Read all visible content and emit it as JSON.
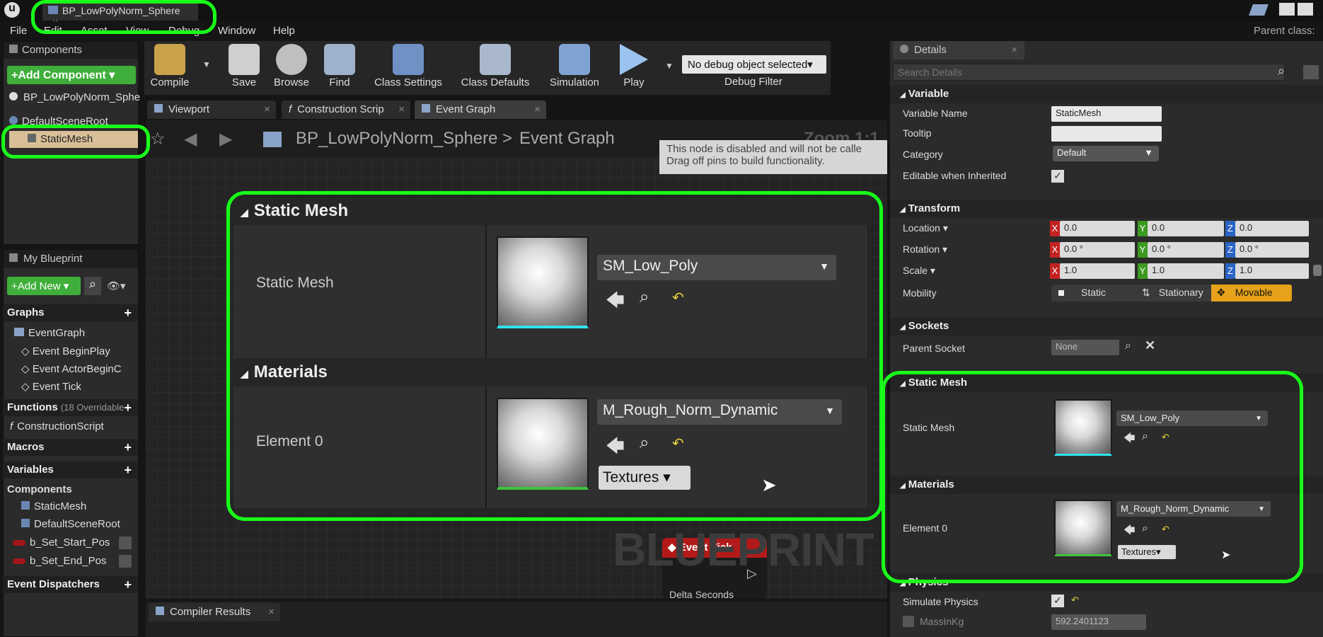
{
  "window": {
    "tab_title": "BP_LowPolyNorm_Sphere",
    "parent_class_label": "Parent class:"
  },
  "menu": [
    "File",
    "Edit",
    "Asset",
    "View",
    "Debug",
    "Window",
    "Help"
  ],
  "components_panel": {
    "title": "Components",
    "add_button": "+Add Component ▾",
    "root": "BP_LowPolyNorm_Sphe",
    "scene_root": "DefaultSceneRoot",
    "selected": "StaticMesh"
  },
  "toolbar": {
    "compile": "Compile",
    "save": "Save",
    "browse": "Browse",
    "find": "Find",
    "class_settings": "Class Settings",
    "class_defaults": "Class Defaults",
    "simulation": "Simulation",
    "play": "Play",
    "debug_select": "No debug object selected▾",
    "debug_filter": "Debug Filter"
  },
  "editor_tabs": [
    "Viewport",
    "Construction Scrip",
    "Event Graph"
  ],
  "breadcrumb": {
    "blueprint": "BP_LowPolyNorm_Sphere",
    "sep": ">",
    "graph": "Event Graph",
    "zoom": "Zoom 1:1"
  },
  "graph_tooltip": {
    "line1": "This node is disabled and will not be calle",
    "line2": "Drag off pins to build functionality."
  },
  "zoomed_details": {
    "static_mesh_header": "Static Mesh",
    "static_mesh_label": "Static Mesh",
    "static_mesh_value": "SM_Low_Poly",
    "materials_header": "Materials",
    "element_label": "Element 0",
    "material_value": "M_Rough_Norm_Dynamic",
    "textures_button": "Textures ▾"
  },
  "graph_node": {
    "event_tick": "Event Tick",
    "delta": "Delta Seconds",
    "watermark": "BLUEPRINT"
  },
  "my_blueprint": {
    "title": "My Blueprint",
    "add_new": "+Add New ▾",
    "graphs": "Graphs",
    "event_graph": "EventGraph",
    "events": [
      "Event BeginPlay",
      "Event ActorBeginC",
      "Event Tick"
    ],
    "functions": "Functions",
    "functions_overrides": "(18 Overridable",
    "construction": "ConstructionScript",
    "macros": "Macros",
    "variables": "Variables",
    "components": "Components",
    "comp_items": [
      "StaticMesh",
      "DefaultSceneRoot"
    ],
    "vars": [
      "b_Set_Start_Pos",
      "b_Set_End_Pos"
    ],
    "dispatchers": "Event Dispatchers"
  },
  "compiler_results": "Compiler Results",
  "details": {
    "title": "Details",
    "search_placeholder": "Search Details",
    "variable": "Variable",
    "variable_name_label": "Variable Name",
    "variable_name": "StaticMesh",
    "tooltip_label": "Tooltip",
    "category_label": "Category",
    "category_value": "Default",
    "editable_label": "Editable when Inherited",
    "transform": "Transform",
    "location": "Location ▾",
    "rotation": "Rotation ▾",
    "scale": "Scale ▾",
    "mobility": "Mobility",
    "loc": [
      "0.0",
      "0.0",
      "0.0"
    ],
    "rot": [
      "0.0 °",
      "0.0 °",
      "0.0 °"
    ],
    "scl": [
      "1.0",
      "1.0",
      "1.0"
    ],
    "mob_static": "Static",
    "mob_stationary": "Stationary",
    "mob_movable": "Movable",
    "sockets": "Sockets",
    "parent_socket_label": "Parent Socket",
    "parent_socket_value": "None",
    "static_mesh_header": "Static Mesh",
    "static_mesh_label": "Static Mesh",
    "static_mesh_value": "SM_Low_Poly",
    "materials_header": "Materials",
    "element_label": "Element 0",
    "material_value": "M_Rough_Norm_Dynamic",
    "textures_button": "Textures▾",
    "physics": "Physics",
    "simulate_label": "Simulate Physics",
    "mass_label": "MassInKg",
    "mass_value": "592.2401123"
  },
  "colors": {
    "highlight": "#19ff19",
    "selected": "#d8bf98",
    "movable": "#e5a21a",
    "x": "#c42121",
    "y": "#3d9a20",
    "z": "#2b64c5"
  }
}
